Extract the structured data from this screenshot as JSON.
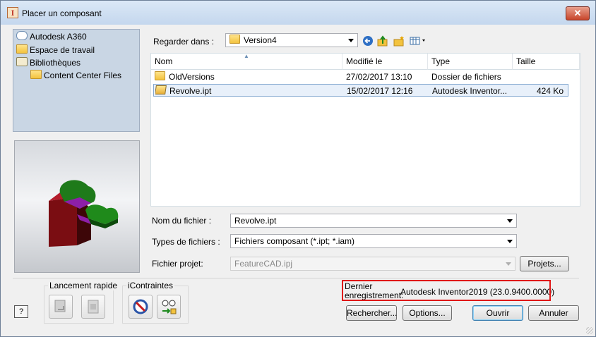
{
  "window": {
    "title": "Placer un composant",
    "close_glyph": "✕"
  },
  "places": [
    {
      "label": "Autodesk A360",
      "icon": "cloud-icon"
    },
    {
      "label": "Espace de travail",
      "icon": "folder-icon"
    },
    {
      "label": "Bibliothèques",
      "icon": "library-icon"
    },
    {
      "label": "Content Center Files",
      "icon": "folder-icon"
    }
  ],
  "location": {
    "label": "Regarder dans :",
    "value": "Version4"
  },
  "toolbar_icons": [
    "back-icon",
    "up-folder-icon",
    "new-folder-icon",
    "view-menu-icon"
  ],
  "columns": [
    "Nom",
    "Modifié le",
    "Type",
    "Taille"
  ],
  "files": [
    {
      "name": "OldVersions",
      "modified": "27/02/2017 13:10",
      "type": "Dossier de fichiers",
      "size": "",
      "icon": "folder-icon",
      "selected": false
    },
    {
      "name": "Revolve.ipt",
      "modified": "15/02/2017 12:16",
      "type": "Autodesk Inventor...",
      "size": "424 Ko",
      "icon": "part-file-icon",
      "selected": true
    }
  ],
  "filename": {
    "label": "Nom du fichier :",
    "value": "Revolve.ipt"
  },
  "filetype": {
    "label": "Types de fichiers :",
    "value": "Fichiers composant (*.ipt; *.iam)"
  },
  "project": {
    "label": "Fichier projet:",
    "value": "FeatureCAD.ipj",
    "button": "Projets..."
  },
  "quick_launch": {
    "title": "Lancement rapide"
  },
  "icontraintes": {
    "title": "iContraintes"
  },
  "last_saved": {
    "label_line1": "Dernier",
    "label_line2": "enregistrement:",
    "value": "Autodesk Inventor2019 (23.0.9400.0000)"
  },
  "buttons": {
    "search": "Rechercher...",
    "options": "Options...",
    "open": "Ouvrir",
    "cancel": "Annuler",
    "help": "?"
  },
  "colors": {
    "highlight_box": "#e01717",
    "selection": "#e8f0fa",
    "places_bg": "#c9d6e4"
  }
}
